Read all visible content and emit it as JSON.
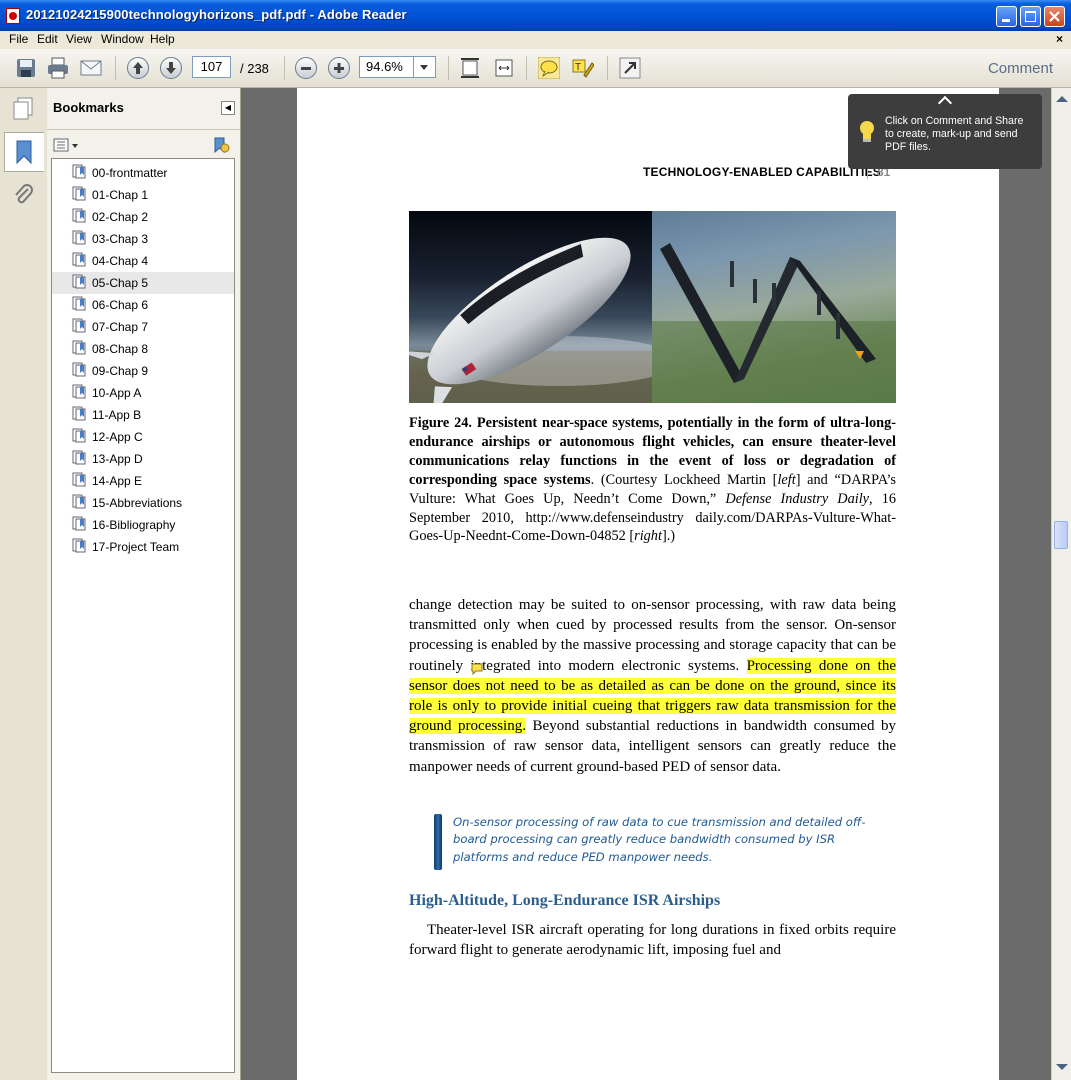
{
  "window": {
    "title": "20121024215900technologyhorizons_pdf.pdf - Adobe Reader"
  },
  "menu": [
    "File",
    "Edit",
    "View",
    "Window",
    "Help"
  ],
  "toolbar": {
    "current_page": "107",
    "total_pages": "/ 238",
    "zoom": "94.6%",
    "comment_label": "Comment"
  },
  "bookmarks": {
    "title": "Bookmarks",
    "items": [
      {
        "label": "00-frontmatter"
      },
      {
        "label": "01-Chap 1"
      },
      {
        "label": "02-Chap 2"
      },
      {
        "label": "03-Chap 3"
      },
      {
        "label": "04-Chap 4"
      },
      {
        "label": "05-Chap 5"
      },
      {
        "label": "06-Chap 6"
      },
      {
        "label": "07-Chap 7"
      },
      {
        "label": "08-Chap 8"
      },
      {
        "label": "09-Chap 9"
      },
      {
        "label": "10-App A"
      },
      {
        "label": "11-App B"
      },
      {
        "label": "12-App C"
      },
      {
        "label": "13-App D"
      },
      {
        "label": "14-App E"
      },
      {
        "label": "15-Abbreviations"
      },
      {
        "label": "16-Bibliography"
      },
      {
        "label": "17-Project Team"
      }
    ],
    "selected_index": 5
  },
  "tooltip": {
    "text": "Click on Comment and Share to create, mark-up and send PDF files."
  },
  "pdf": {
    "running_head": "TECHNOLOGY-ENABLED CAPABILITIES",
    "page_number": "81",
    "figure_caption": {
      "bold": "Figure 24. Persistent near-space systems, potentially in the form of ultra-long-endurance airships or autonomous flight vehicles, can ensure theater-level communications relay functions in the event of loss or degradation of corresponding space systems",
      "p1": ". (Courtesy Lockheed Martin [",
      "left": "left",
      "p2": "] and “DARPA’s Vulture: What Goes Up, Needn’t Come Down,” ",
      "journal": "Defense Industry Daily",
      "p3": ", 16 September 2010, http://www.defenseindustry daily.com/DARPAs-Vulture-What-Goes-Up-Neednt-Come-Down-04852 [",
      "right": "right",
      "p4": "].)"
    },
    "para1_before": "change detection may be suited to on-sensor processing, with raw data being transmitted only when cued by processed results from the sensor. On-sensor processing is enabled by the massive processing and storage capacity that can be routinely integrated into modern electronic systems. ",
    "para1_highlight": "Processing done on the sensor does not need to be as detailed as can be done on the ground, since its role is only to provide initial cueing that triggers raw data transmission for the ground processing.",
    "para1_after": " Beyond substantial reductions in bandwidth consumed by transmission of raw sensor data, intelligent sensors can greatly reduce the manpower needs of current ground-based PED of sensor data.",
    "callout": "On-sensor processing of raw data to cue transmission and detailed off-board processing can greatly reduce bandwidth consumed by ISR platforms and reduce PED manpower needs.",
    "section_heading": "High-Altitude, Long-Endurance ISR Airships",
    "para2": "Theater-level ISR aircraft operating for long durations in fixed orbits require forward flight to generate aerodynamic lift, imposing fuel and"
  }
}
